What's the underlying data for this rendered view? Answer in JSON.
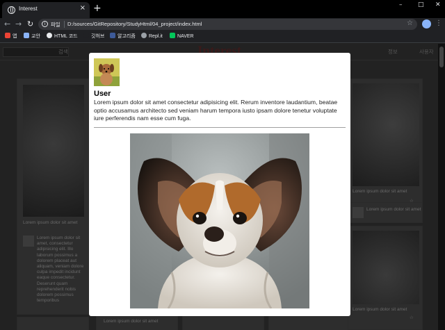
{
  "browser": {
    "tab_title": "Interest",
    "tab_close": "×",
    "new_tab": "+",
    "window_controls": {
      "minimize": "–",
      "maximize": "□",
      "close": "✕"
    },
    "nav": {
      "back": "←",
      "forward": "→",
      "reload": "↻"
    },
    "address": {
      "scheme_label": "파일",
      "url": "D:/sources/GitRepository/StudyHtml/04_project/index.html",
      "info_glyph": "i"
    },
    "bookmark_star": "☆",
    "menu_glyph": "⋮",
    "bookmarks": [
      {
        "label": "앱",
        "icon": "apps-grid-icon",
        "color": "#ea4335"
      },
      {
        "label": "교안",
        "icon": "bookmark-icon",
        "color": "#8ab4f8"
      },
      {
        "label": "HTML 코드",
        "icon": "github-icon",
        "color": "#e8eaed"
      },
      {
        "label": "깃허브",
        "icon": "github-icon",
        "color": "#202124"
      },
      {
        "label": "알고리즘",
        "icon": "jo-icon",
        "color": "#3d5a98"
      },
      {
        "label": "Repl.it",
        "icon": "replit-icon",
        "color": "#9aa0a6"
      },
      {
        "label": "NAVER",
        "icon": "naver-icon",
        "color": "#03c75a"
      }
    ]
  },
  "site": {
    "search_button": "검색",
    "logo": "Interest",
    "nav_items": [
      "정보",
      "사용자"
    ],
    "left_card_caption": "Lorem ipsum dolor sit amet",
    "left_card_text": "Lorem ipsum dolor sit amet, consectetur adipisicing elit. Illo laborum possimus a dolorem placeat aut aliquam, veniam dolore culpa impedit incidunt eaque consectetur. Deserunt quam reprehenderit nobis dolorem possimus temporibus",
    "right_card_caption": "Lorem ipsum dolor sit amet",
    "right_row_text": "Lorem ipsum dolor sit amet",
    "bottom_caption": "Lorem ipsum dolor sit amet"
  },
  "modal": {
    "username": "User",
    "description": "Lorem ipsum dolor sit amet consectetur adipisicing elit. Rerum inventore laudantium, beatae optio accusamus architecto sed veniam harum tempora iusto ipsam dolore tenetur voluptate iure perferendis nam esse cum fuga."
  }
}
